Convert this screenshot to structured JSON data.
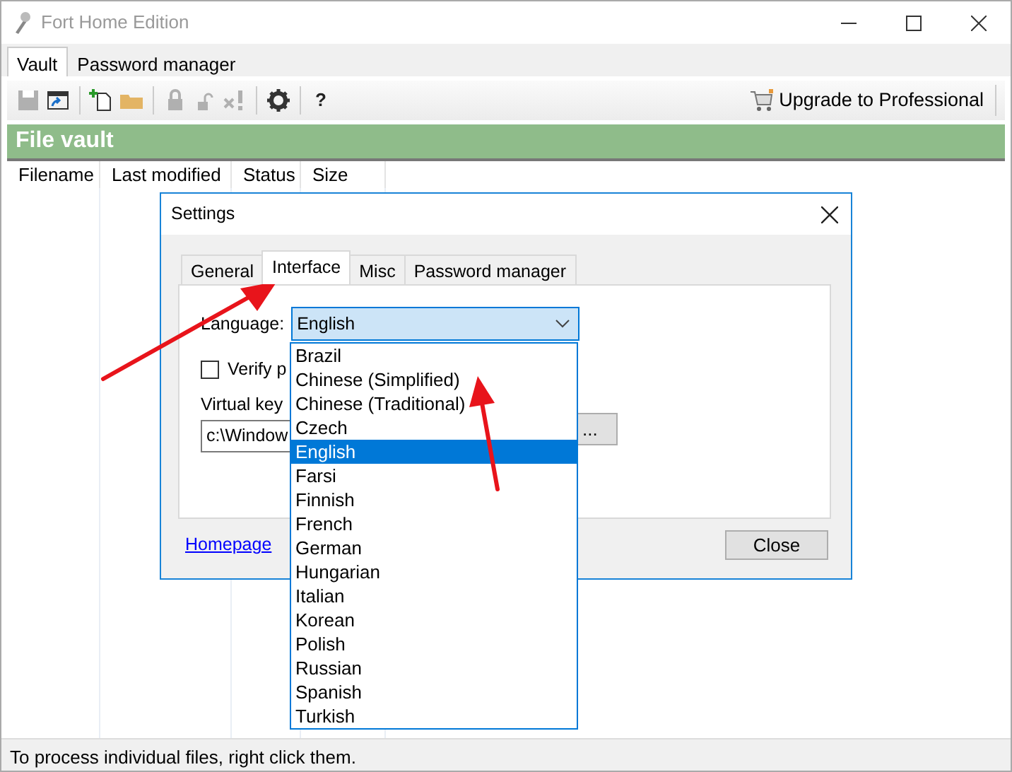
{
  "window": {
    "title": "Fort Home Edition"
  },
  "menu": [
    {
      "label": "Vault",
      "selected": true
    },
    {
      "label": "Password manager",
      "selected": false
    }
  ],
  "toolbar": {
    "items": [
      {
        "kind": "save",
        "disabled": true
      },
      {
        "kind": "window",
        "disabled": false
      },
      {
        "kind": "sep"
      },
      {
        "kind": "new",
        "disabled": false
      },
      {
        "kind": "folder",
        "disabled": false
      },
      {
        "kind": "sep"
      },
      {
        "kind": "lock",
        "disabled": true
      },
      {
        "kind": "unlock",
        "disabled": true
      },
      {
        "kind": "remove",
        "disabled": true
      },
      {
        "kind": "sep"
      },
      {
        "kind": "gear",
        "disabled": false
      },
      {
        "kind": "sep"
      },
      {
        "kind": "help",
        "label": "?",
        "disabled": false
      }
    ],
    "upgrade_button": "Upgrade to Professional"
  },
  "vault": {
    "title": "File vault",
    "columns": [
      "Filename",
      "Last modified",
      "Status",
      "Size"
    ]
  },
  "status_bar": "To process individual files, right click them.",
  "dialog": {
    "title": "Settings",
    "tabs": [
      {
        "label": "General",
        "selected": false
      },
      {
        "label": "Interface",
        "selected": true
      },
      {
        "label": "Misc",
        "selected": false
      },
      {
        "label": "Password manager",
        "selected": false
      }
    ],
    "language_label": "Language:",
    "language_value": "English",
    "verify_checkbox": {
      "label": "Verify p",
      "checked": false
    },
    "virtual_keyboard_label": "Virtual key",
    "path_value": "c:\\Window",
    "browse_button": "...",
    "link": "Homepage",
    "close_button": "Close",
    "dropdown_options": [
      {
        "label": "Brazil",
        "selected": false
      },
      {
        "label": "Chinese (Simplified)",
        "selected": false
      },
      {
        "label": "Chinese (Traditional)",
        "selected": false
      },
      {
        "label": "Czech",
        "selected": false
      },
      {
        "label": "English",
        "selected": true
      },
      {
        "label": "Farsi",
        "selected": false
      },
      {
        "label": "Finnish",
        "selected": false
      },
      {
        "label": "French",
        "selected": false
      },
      {
        "label": "German",
        "selected": false
      },
      {
        "label": "Hungarian",
        "selected": false
      },
      {
        "label": "Italian",
        "selected": false
      },
      {
        "label": "Korean",
        "selected": false
      },
      {
        "label": "Polish",
        "selected": false
      },
      {
        "label": "Russian",
        "selected": false
      },
      {
        "label": "Spanish",
        "selected": false
      },
      {
        "label": "Turkish",
        "selected": false
      }
    ]
  }
}
